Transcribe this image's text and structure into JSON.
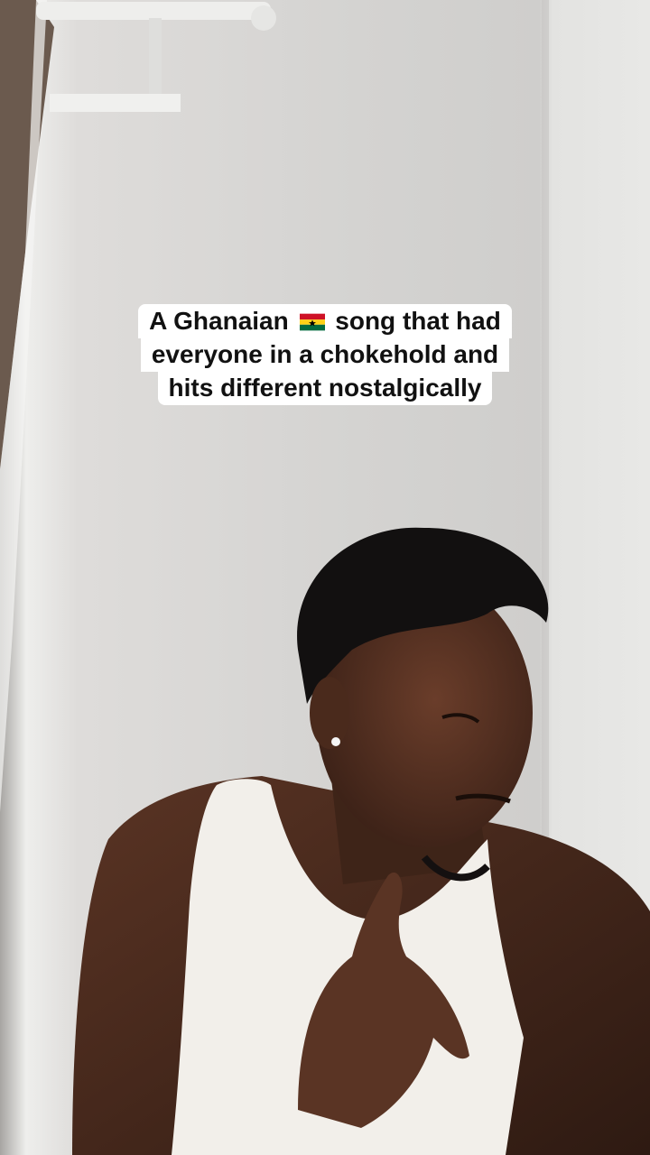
{
  "caption": {
    "line1_before_flag": "A Ghanaian ",
    "flag_icon": "ghana-flag-icon",
    "line1_after_flag": " song that had",
    "line2": "everyone in a chokehold and",
    "line3": "hits different nostalgically"
  },
  "colors": {
    "wall": "#d9d9d7",
    "caption_bg": "#ffffff",
    "caption_text": "#111111",
    "tank_top": "#f2efea",
    "skin": "#4a2a1c"
  }
}
